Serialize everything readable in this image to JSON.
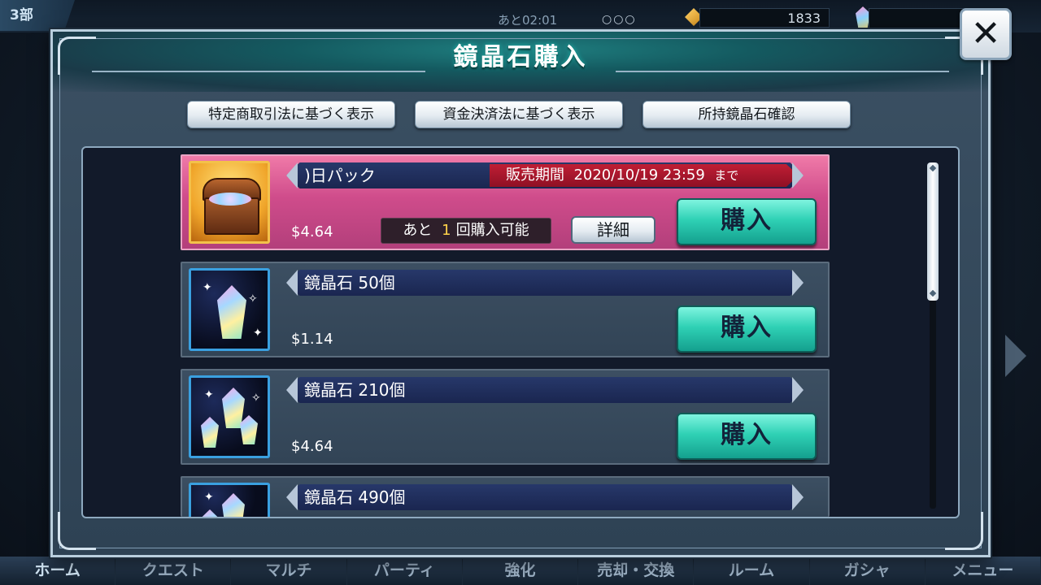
{
  "background": {
    "chapter": "3部",
    "timer": "あと02:01",
    "stamina_dots": "○○○",
    "gem_count": "1833",
    "nav": [
      "ホーム",
      "クエスト",
      "マルチ",
      "パーティ",
      "強化",
      "売却・交換",
      "ルーム",
      "ガシャ",
      "メニュー"
    ]
  },
  "modal": {
    "title": "鏡晶石購入",
    "close_icon": "close-icon",
    "info_buttons": [
      "特定商取引法に基づく表示",
      "資金決済法に基づく表示",
      "所持鏡晶石確認"
    ]
  },
  "items": [
    {
      "name": ")日パック",
      "period_label": "販売期間",
      "period_date": "2020/10/19 23:59",
      "period_suffix": "まで",
      "price": "$4.64",
      "remaining_prefix": "あと",
      "remaining_count": "1",
      "remaining_suffix": "回購入可能",
      "detail_label": "詳細",
      "buy_label": "購入",
      "icon": "treasure-chest-icon"
    },
    {
      "name": "鏡晶石 50個",
      "price": "$1.14",
      "buy_label": "購入",
      "icon": "crystal-icon"
    },
    {
      "name": "鏡晶石 210個",
      "price": "$4.64",
      "buy_label": "購入",
      "icon": "crystal-cluster-icon"
    },
    {
      "name": "鏡晶石 490個",
      "icon": "crystal-cluster-icon"
    }
  ],
  "colors": {
    "accent_teal": "#2fd1b5",
    "featured_pink": "#cf4c8b",
    "period_red": "#c01e35",
    "remaining_yellow": "#ffd24a"
  }
}
